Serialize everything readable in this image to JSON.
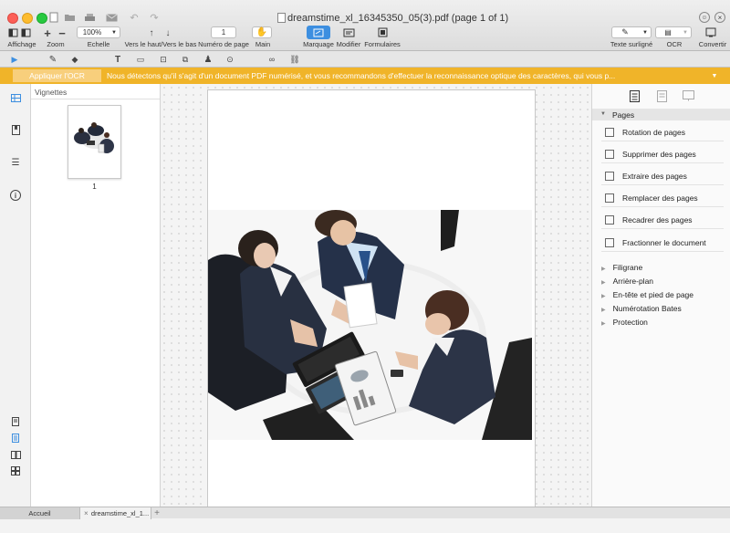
{
  "window": {
    "title": "dreamstime_xl_16345350_05(3).pdf (page 1 of 1)"
  },
  "toolbar": {
    "affichage": "Affichage",
    "zoom": "Zoom",
    "zoom_value": "100%",
    "echelle": "Echelle",
    "haut_bas": "Vers le haut/Vers le bas",
    "page_num_value": "1",
    "page_num": "Numéro de page",
    "main": "Main",
    "marquage": "Marquage",
    "modifier": "Modifier",
    "formulaires": "Formulaires",
    "texte_surligne": "Texte surligné",
    "ocr": "OCR",
    "convertir": "Convertir"
  },
  "ocr_bar": {
    "button": "Appliquer l'OCR",
    "message": "Nous détectons qu'il s'agit d'un document PDF numérisé, et vous recommandons d'effectuer la reconnaissance optique des caractères, qui vous p...",
    "chevron": "▼"
  },
  "thumbs": {
    "header": "Vignettes",
    "page_label": "1"
  },
  "right_panel": {
    "section": "Pages",
    "tools": [
      "Rotation de pages",
      "Supprimer des pages",
      "Extraire des pages",
      "Remplacer des pages",
      "Recadrer des pages",
      "Fractionner le document"
    ],
    "sections": [
      "Filigrane",
      "Arrière-plan",
      "En-tête et pied de page",
      "Numérotation Bates",
      "Protection"
    ]
  },
  "tabs": {
    "home": "Accueil",
    "doc": "dreamstime_xl_1..."
  },
  "colors": {
    "ocr_bar": "#f0b429",
    "accent": "#3d8fe0"
  }
}
